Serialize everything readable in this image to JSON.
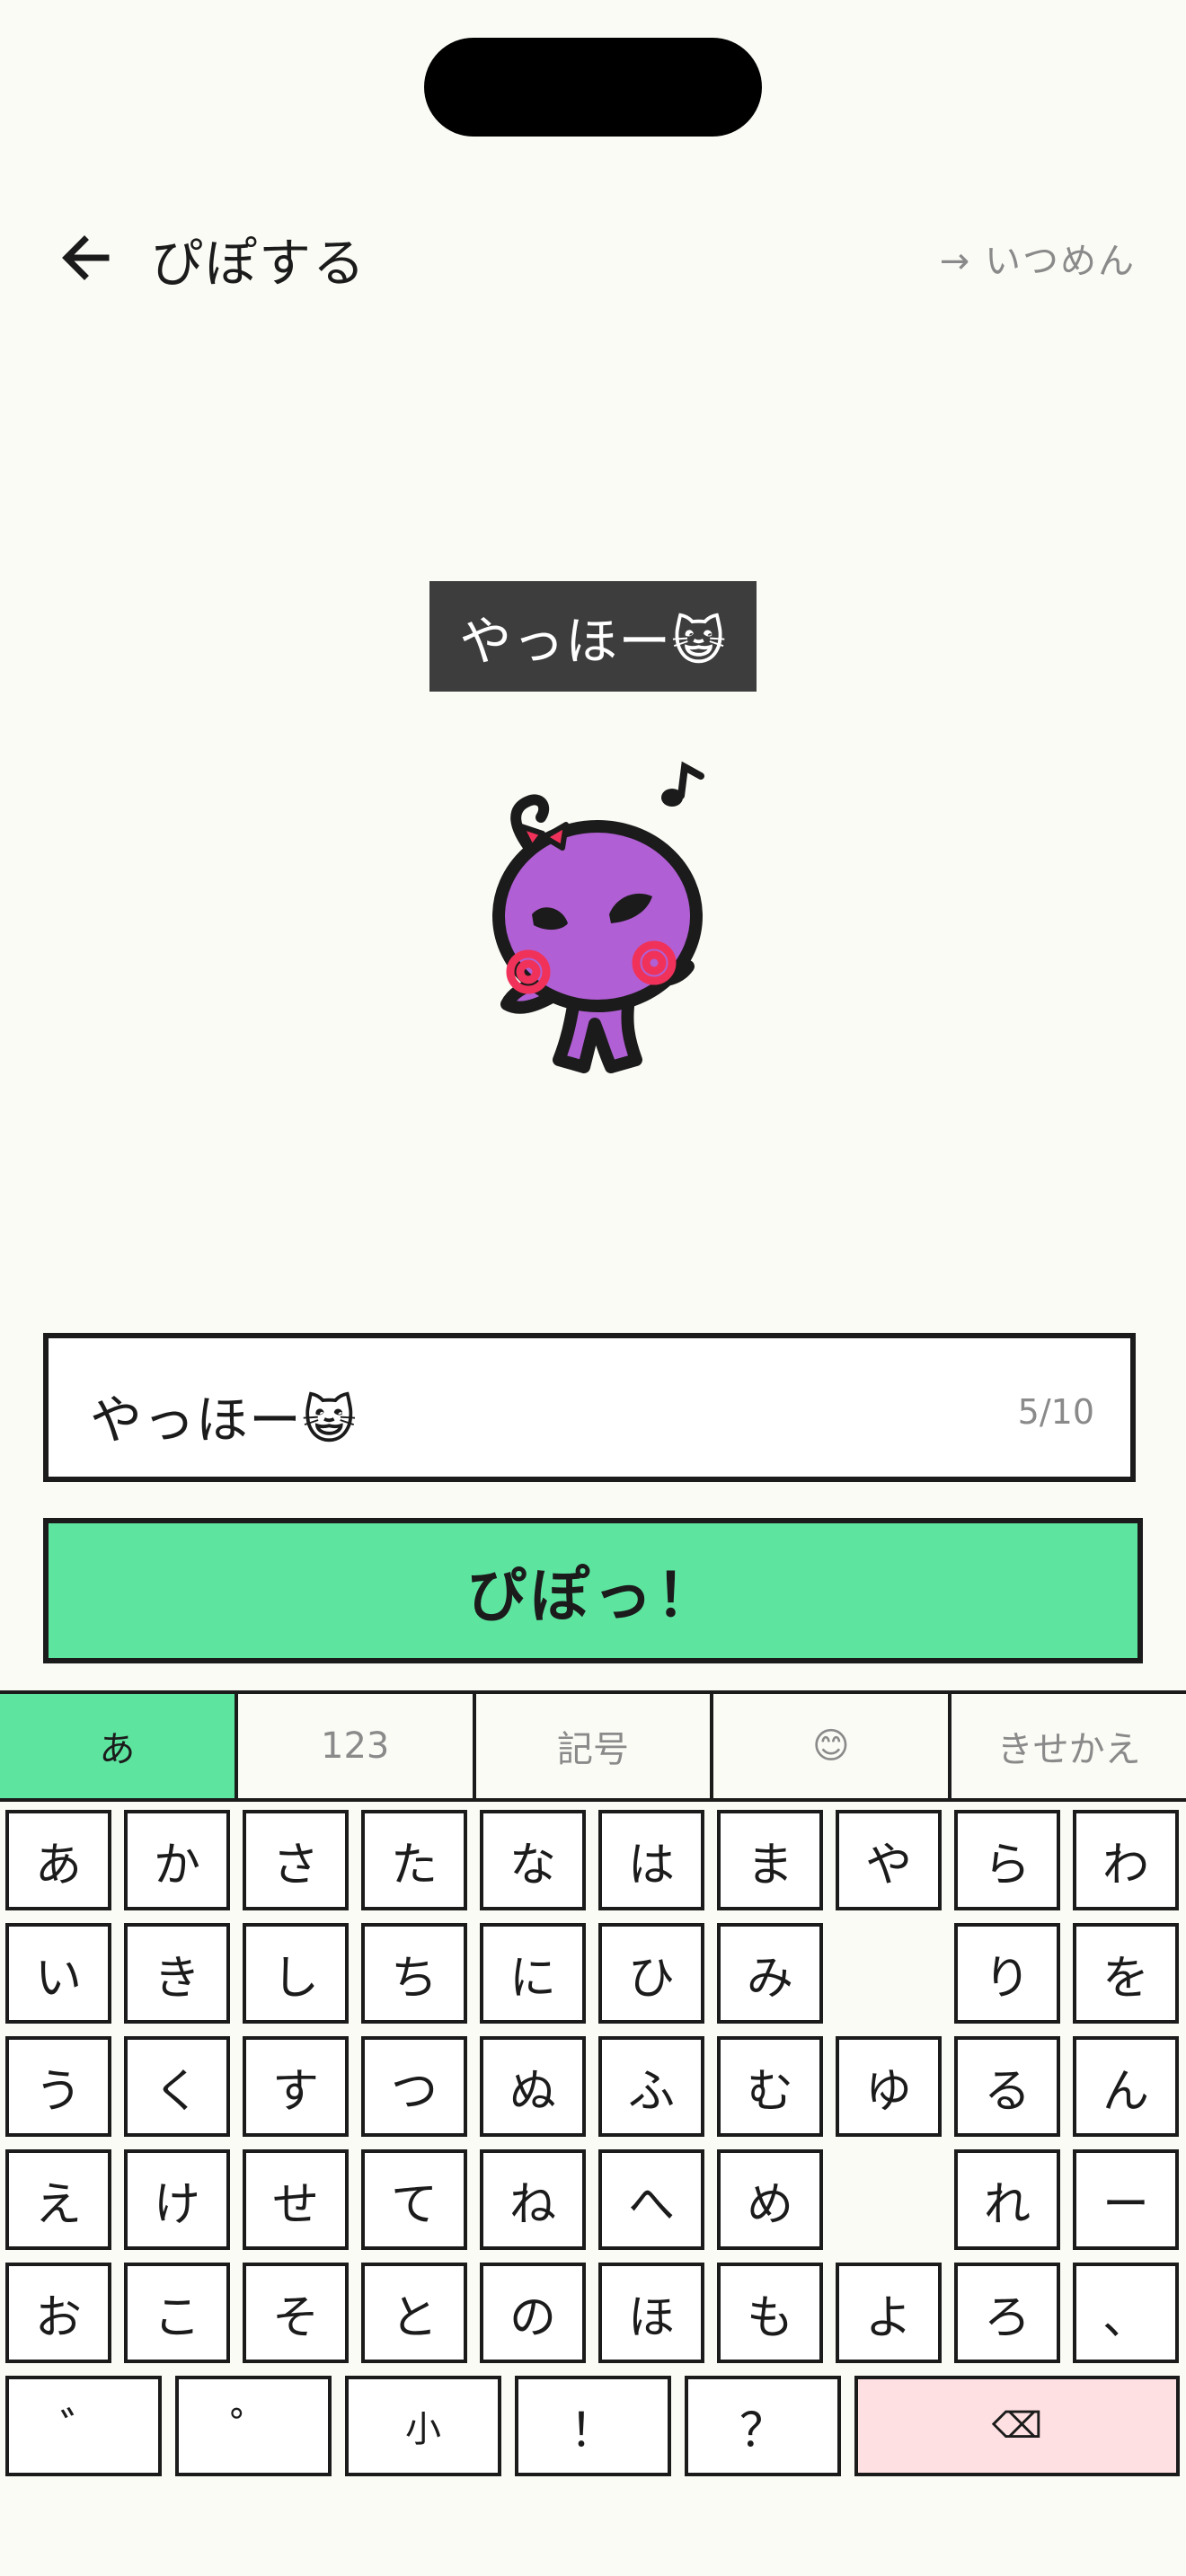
{
  "header": {
    "title": "ぴぽする",
    "link": "→ いつめん"
  },
  "bubble": {
    "text": "やっほー😺"
  },
  "input": {
    "value": "やっほー😺",
    "counter": "5/10"
  },
  "send_button": {
    "label": "ぴぽっ！"
  },
  "tabs": [
    {
      "label": "あ",
      "active": true
    },
    {
      "label": "123",
      "active": false
    },
    {
      "label": "記号",
      "active": false
    },
    {
      "label": "😊",
      "active": false
    },
    {
      "label": "きせかえ",
      "active": false
    }
  ],
  "keyboard": {
    "rows": [
      [
        "あ",
        "か",
        "さ",
        "た",
        "な",
        "は",
        "ま",
        "や",
        "ら",
        "わ"
      ],
      [
        "い",
        "き",
        "し",
        "ち",
        "に",
        "ひ",
        "み",
        "",
        "り",
        "を"
      ],
      [
        "う",
        "く",
        "す",
        "つ",
        "ぬ",
        "ふ",
        "む",
        "ゆ",
        "る",
        "ん"
      ],
      [
        "え",
        "け",
        "せ",
        "て",
        "ね",
        "へ",
        "め",
        "",
        "れ",
        "ー"
      ],
      [
        "お",
        "こ",
        "そ",
        "と",
        "の",
        "ほ",
        "も",
        "よ",
        "ろ",
        "、"
      ]
    ],
    "bottom": [
      {
        "label": "゛",
        "name": "dakuten-key"
      },
      {
        "label": "゜",
        "name": "handakuten-key"
      },
      {
        "label": "小",
        "name": "small-kana-key"
      },
      {
        "label": "！",
        "name": "exclamation-key"
      },
      {
        "label": "？",
        "name": "question-key"
      }
    ],
    "delete_label": "⌫"
  },
  "colors": {
    "background": "#fbfbf6",
    "accent_green": "#5de5a0",
    "bubble_bg": "#3d3d3d",
    "delete_bg": "#ffe0e2",
    "character_purple": "#b15fd4",
    "cheek_pink": "#f0325a"
  }
}
